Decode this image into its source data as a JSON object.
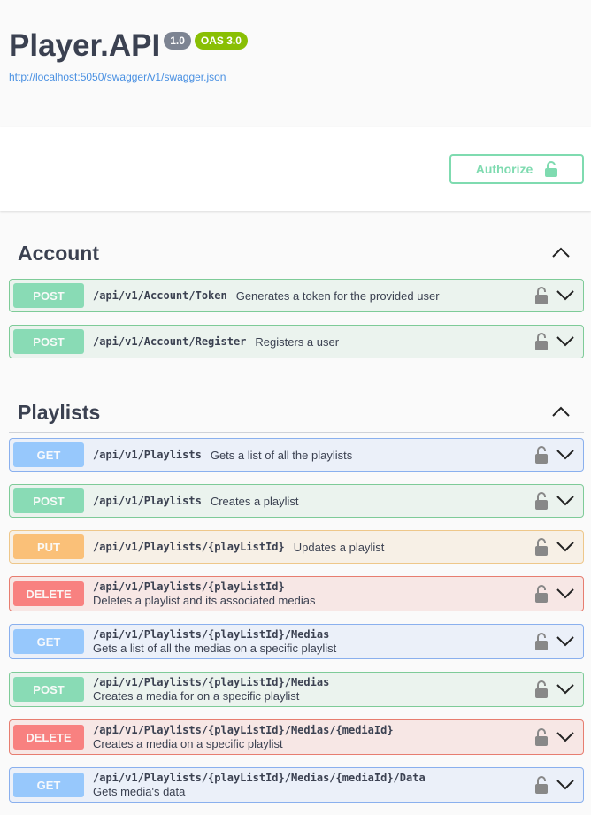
{
  "header": {
    "title": "Player.API",
    "version": "1.0",
    "oas": "OAS 3.0",
    "url": "http://localhost:5050/swagger/v1/swagger.json"
  },
  "authorize_label": "Authorize",
  "colors": {
    "post": "#49cc90",
    "get": "#61affe",
    "put": "#fca130",
    "delete": "#f93e3e"
  },
  "tags": [
    {
      "name": "Account",
      "ops": [
        {
          "method": "POST",
          "path": "/api/v1/Account/Token",
          "desc": "Generates a token for the provided user"
        },
        {
          "method": "POST",
          "path": "/api/v1/Account/Register",
          "desc": "Registers a user"
        }
      ]
    },
    {
      "name": "Playlists",
      "ops": [
        {
          "method": "GET",
          "path": "/api/v1/Playlists",
          "desc": "Gets a list of all the playlists"
        },
        {
          "method": "POST",
          "path": "/api/v1/Playlists",
          "desc": "Creates a playlist"
        },
        {
          "method": "PUT",
          "path": "/api/v1/Playlists/{playListId}",
          "desc": "Updates a playlist"
        },
        {
          "method": "DELETE",
          "path": "/api/v1/Playlists/{playListId}",
          "desc": "Deletes a playlist and its associated medias",
          "two": true
        },
        {
          "method": "GET",
          "path": "/api/v1/Playlists/{playListId}/Medias",
          "desc": "Gets a list of all the medias on a specific playlist",
          "two": true
        },
        {
          "method": "POST",
          "path": "/api/v1/Playlists/{playListId}/Medias",
          "desc": "Creates a media for on a specific playlist",
          "two": true
        },
        {
          "method": "DELETE",
          "path": "/api/v1/Playlists/{playListId}/Medias/{mediaId}",
          "desc": "Creates a media on a specific playlist",
          "two": true
        },
        {
          "method": "GET",
          "path": "/api/v1/Playlists/{playListId}/Medias/{mediaId}/Data",
          "desc": "Gets media's data",
          "two": true
        }
      ]
    }
  ]
}
